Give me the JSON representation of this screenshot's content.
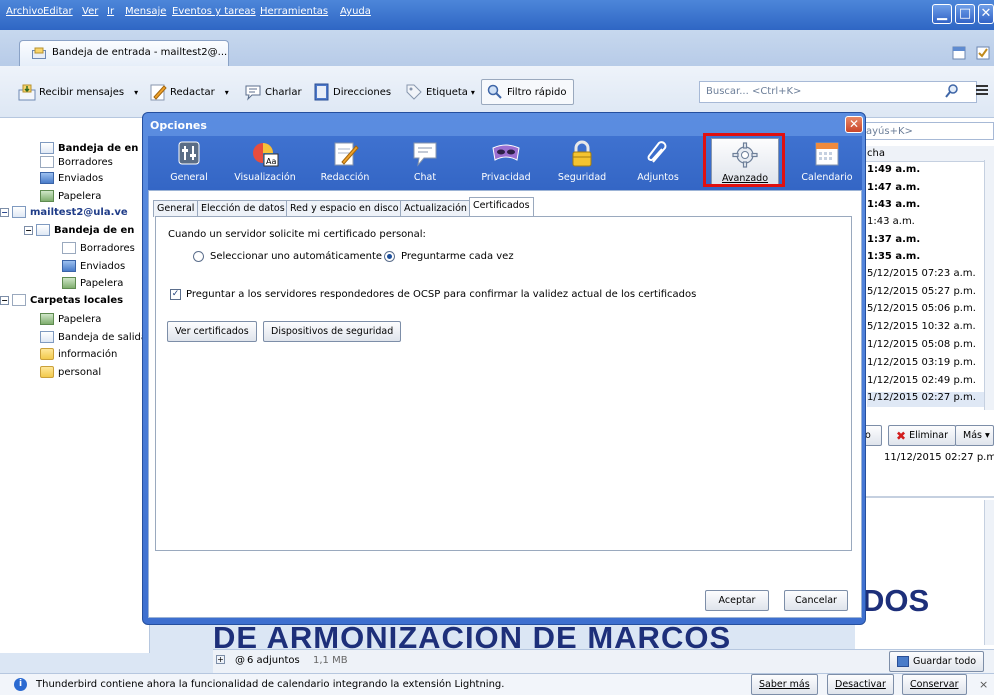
{
  "menu": [
    "Archivo",
    "Editar",
    "Ver",
    "Ir",
    "Mensaje",
    "Eventos y tareas",
    "Herramientas",
    "Ayuda"
  ],
  "tab": {
    "label": "Bandeja de entrada - mailtest2@..."
  },
  "toolbar": {
    "receive": "Recibir mensajes",
    "compose": "Redactar",
    "chat": "Charlar",
    "addressbook": "Direcciones",
    "tag": "Etiqueta",
    "quickfilter": "Filtro rápido",
    "search_placeholder": "Buscar... <Ctrl+K>"
  },
  "folders": [
    {
      "label": "Bandeja de en",
      "bold": true
    },
    {
      "label": "Borradores"
    },
    {
      "label": "Enviados"
    },
    {
      "label": "Papelera"
    },
    {
      "label": "mailtest2@ula.ve",
      "bold": true
    },
    {
      "label": "Bandeja de en",
      "bold": true
    },
    {
      "label": "Borradores"
    },
    {
      "label": "Enviados"
    },
    {
      "label": "Papelera"
    },
    {
      "label": "Carpetas locales",
      "bold": true
    },
    {
      "label": "Papelera"
    },
    {
      "label": "Bandeja de salida"
    },
    {
      "label": "información"
    },
    {
      "label": "personal"
    }
  ],
  "right": {
    "search": "ayús+K>",
    "date_header": "cha",
    "dates": [
      "1:49 a.m.",
      "1:47 a.m.",
      "1:43 a.m.",
      "1:43 a.m.",
      "1:37 a.m.",
      "1:35 a.m.",
      "5/12/2015 07:23 a.m.",
      "5/12/2015 05:27 p.m.",
      "5/12/2015 05:06 p.m.",
      "5/12/2015 10:32 a.m.",
      "1/12/2015 05:08 p.m.",
      "1/12/2015 03:19 p.m.",
      "1/12/2015 02:49 p.m.",
      "1/12/2015 02:27 p.m."
    ],
    "delete_btn": "Eliminar",
    "more_btn": "Más",
    "msg_date": "11/12/2015 02:27 p.m."
  },
  "dialog": {
    "title": "Opciones",
    "panes": [
      "General",
      "Visualización",
      "Redacción",
      "Chat",
      "Privacidad",
      "Seguridad",
      "Adjuntos",
      "Avanzado",
      "Calendario"
    ],
    "subtabs": [
      "General",
      "Elección de datos",
      "Red y espacio en disco",
      "Actualización",
      "Certificados"
    ],
    "cert_prompt": "Cuando un servidor solicite mi certificado personal:",
    "radio_auto": "Seleccionar uno automáticamente",
    "radio_ask": "Preguntarme cada vez",
    "ocsp": "Preguntar a los servidores respondedores de OCSP para confirmar la validez actual de los certificados",
    "view_certs": "Ver certificados",
    "security_devices": "Dispositivos de seguridad",
    "accept": "Aceptar",
    "cancel": "Cancelar"
  },
  "message": {
    "heading": "DE ARMONIZACION DE MARCOS",
    "heading_right": "DOS"
  },
  "attachments": {
    "label": "6 adjuntos",
    "size": "1,1 MB",
    "save_all": "Guardar todo"
  },
  "notification": {
    "text": "Thunderbird contiene ahora la funcionalidad de calendario integrando la extensión Lightning.",
    "learn_more": "Saber más",
    "disable": "Desactivar",
    "keep": "Conservar"
  }
}
